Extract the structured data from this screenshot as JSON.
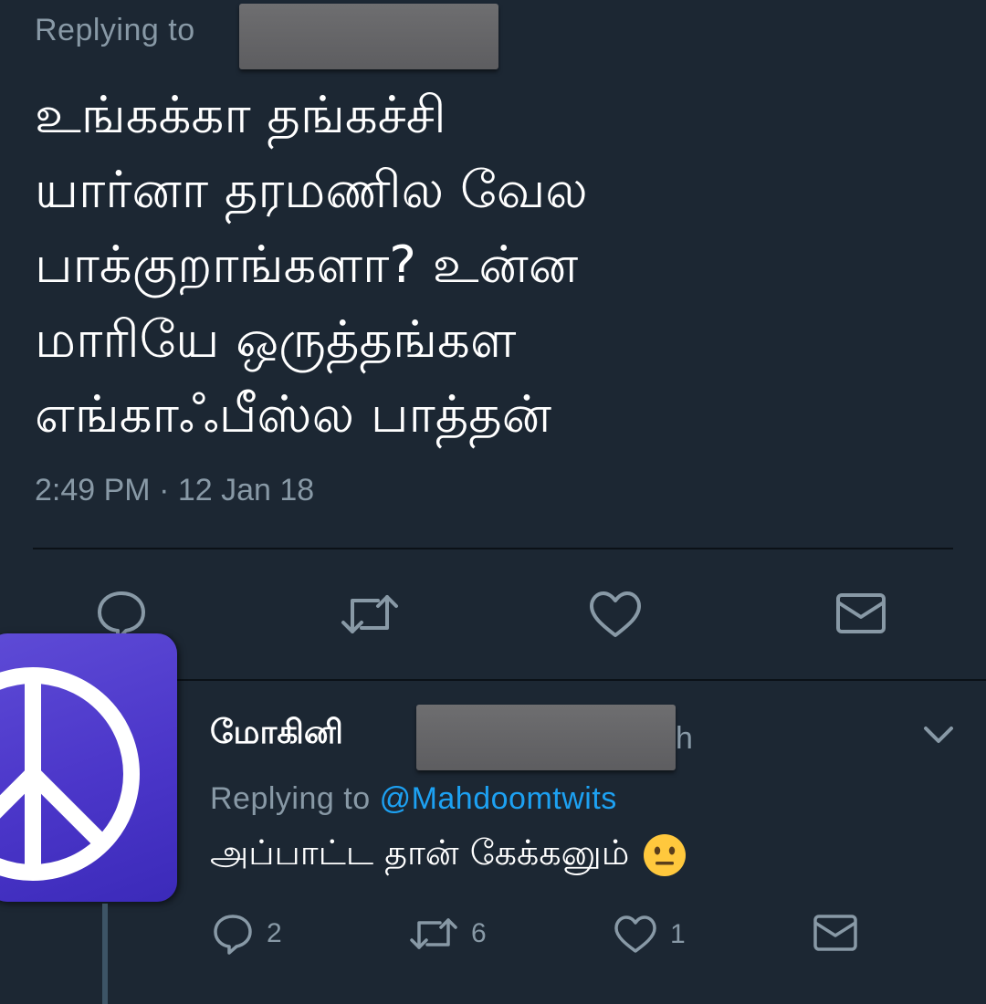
{
  "main_tweet": {
    "replying_label": "Replying to",
    "lines": [
      "உங்கக்கா தங்கச்சி",
      "யார்னா தரமணில வேல",
      "பாக்குறாங்களா? உன்ன",
      "மாரியே ஒருத்தங்கள",
      "எங்காஃபீஸ்ல பாத்தன்"
    ],
    "timestamp": "2:49 PM · 12 Jan 18",
    "actions": {
      "reply_icon": "reply-icon",
      "retweet_icon": "retweet-icon",
      "like_icon": "heart-icon",
      "dm_icon": "mail-icon"
    }
  },
  "reply_tweet": {
    "display_name": "மோகினி",
    "name_tail": "h",
    "replying_label": "Replying to",
    "replying_handle": "@Mahdoomtwits",
    "text": "அப்பாட்ட தான் கேக்கனும்",
    "emoji": "neutral-face-emoji",
    "reply_count": "2",
    "retweet_count": "6",
    "like_count": "1",
    "avatar_icon": "peace-sign-icon"
  },
  "colors": {
    "background": "#1c2733",
    "secondary_text": "#8899a6",
    "link": "#1da1f2",
    "avatar": "#4b36c9"
  }
}
